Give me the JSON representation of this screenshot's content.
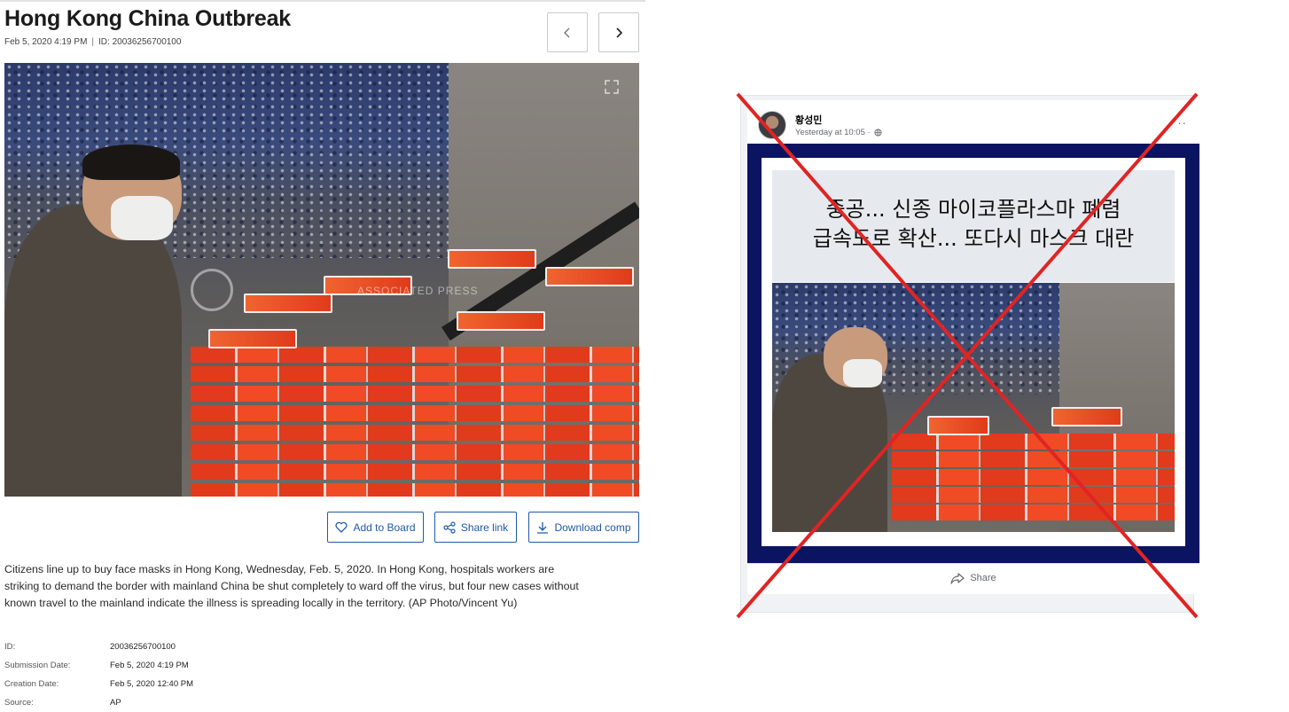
{
  "ap": {
    "title": "Hong Kong China Outbreak",
    "date": "Feb 5, 2020 4:19 PM",
    "id_label": "ID: 20036256700100",
    "photo_watermark": "ASSOCIATED PRESS",
    "buttons": {
      "add_to_board": "Add to Board",
      "share_link": "Share link",
      "download_comp": "Download comp"
    },
    "caption": "Citizens line up to buy face masks in Hong Kong, Wednesday, Feb. 5, 2020. In Hong Kong, hospitals workers are striking to demand the border with mainland China be shut completely to ward off the virus, but four new cases without known travel to the mainland indicate the illness is spreading locally in the territory. (AP Photo/Vincent Yu)",
    "metadata": [
      {
        "key": "ID:",
        "value": "20036256700100"
      },
      {
        "key": "Submission Date:",
        "value": "Feb 5, 2020 4:19 PM"
      },
      {
        "key": "Creation Date:",
        "value": "Feb 5, 2020 12:40 PM"
      },
      {
        "key": "Source:",
        "value": "AP"
      }
    ]
  },
  "fb": {
    "author": "황성민",
    "timestamp": "Yesterday at 10:05 ·",
    "headline_line1": "중공... 신종 마이코플라스마 폐렴",
    "headline_line2": "급속도로 확산... 또다시 마스크 대란",
    "share_label": "Share",
    "cross_color": "#e02424"
  }
}
